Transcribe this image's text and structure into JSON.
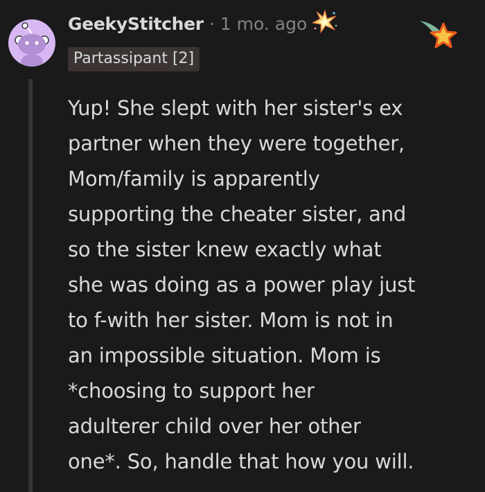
{
  "comment": {
    "username": "GeekyStitcher",
    "separator": "·",
    "timestamp": "1 mo. ago",
    "flair": "Partassipant [2]",
    "body_lines": [
      "Yup! She slept with her sister's ex",
      "partner when they were together,",
      "Mom/family is apparently",
      "supporting the cheater sister, and",
      "so the sister knew exactly what",
      "she was doing as a power play just",
      "to f-with her sister. Mom is not in",
      "an impossible situation. Mom is",
      "*choosing to support her",
      "adulterer child over her other",
      "one*. So, handle that how you will."
    ]
  },
  "icons": {
    "avatar": "reddit-snoo-avatar-icon",
    "award": "sparkle-award-icon",
    "badge": "star-badge-icon"
  },
  "colors": {
    "background": "#1a1a1b",
    "text": "#d7dadc",
    "meta": "#818384",
    "avatar_bg": "#d7b8f3",
    "flair_bg": "#3b3433",
    "thread_line": "#343536"
  }
}
